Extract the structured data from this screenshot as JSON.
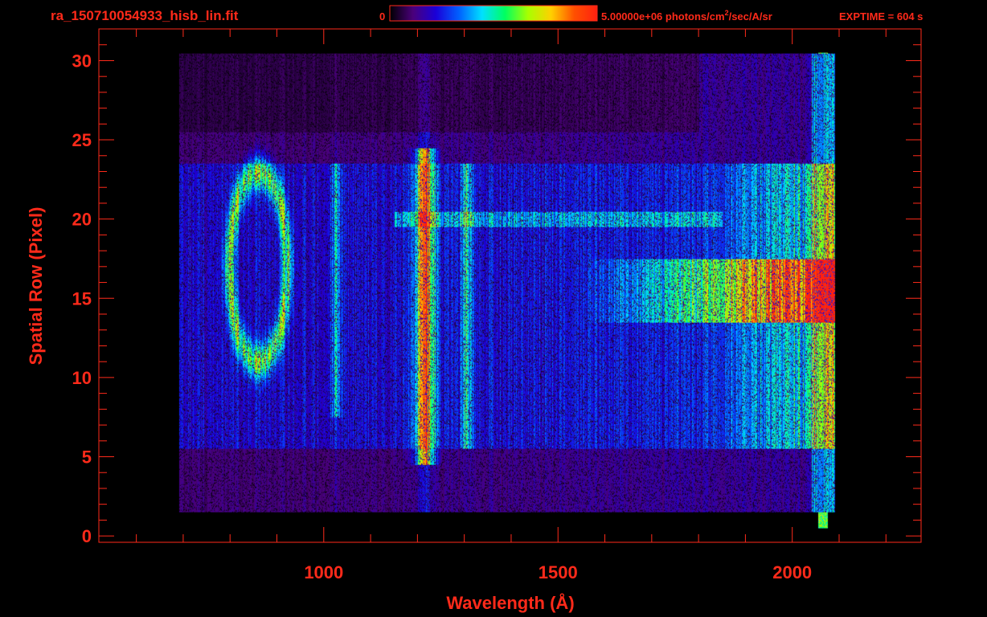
{
  "chart_data": {
    "type": "heatmap",
    "title": "ra_150710054933_hisb_lin.fit",
    "colorbar": {
      "min_label": "0",
      "max_label": "5.00000e+06 photons/cm",
      "unit_superscript": "2",
      "unit_suffix": "/sec/A/sr",
      "colormap": "rainbow",
      "colors": [
        "#000000",
        "#4a007a",
        "#1a00d8",
        "#0060ff",
        "#00e0ff",
        "#00ff60",
        "#a8ff00",
        "#ffd000",
        "#ff5000",
        "#ff2010"
      ]
    },
    "exptime": "EXPTIME = 604 s",
    "xlabel": "Wavelength (Å)",
    "ylabel": "Spatial Row (Pixel)",
    "xlim": [
      520,
      2275
    ],
    "ylim": [
      -0.4,
      32
    ],
    "xticks": [
      1000,
      1500,
      2000
    ],
    "xtick_labels": [
      "1000",
      "1500",
      "2000"
    ],
    "yticks": [
      0,
      5,
      10,
      15,
      20,
      25,
      30
    ],
    "ytick_labels": [
      "0",
      "5",
      "10",
      "15",
      "20",
      "25",
      "30"
    ],
    "x_minor_step": 100,
    "y_minor_step": 1,
    "wavelength_range": [
      690,
      2090
    ],
    "rows_range": [
      0,
      30
    ],
    "features": [
      {
        "name": "Lyman-alpha",
        "center": 1216,
        "rows": [
          5,
          24
        ],
        "peak": 0.92
      },
      {
        "name": "O I",
        "center": 1304,
        "rows": [
          6,
          23
        ],
        "peak": 0.45
      },
      {
        "name": "line 1025",
        "center": 1026,
        "rows": [
          8,
          23
        ],
        "peak": 0.35
      },
      {
        "name": "bright continuum",
        "wavelength_start": 1550,
        "rows": [
          14,
          17
        ],
        "peak": 0.85
      },
      {
        "name": "extended emission",
        "wavelength_start": 1800,
        "rows": [
          6,
          23
        ],
        "peak": 0.45
      },
      {
        "name": "ring",
        "center_x": 860,
        "center_y": 17,
        "radius_x": 65,
        "radius_y": 6,
        "peak": 0.55
      }
    ]
  }
}
